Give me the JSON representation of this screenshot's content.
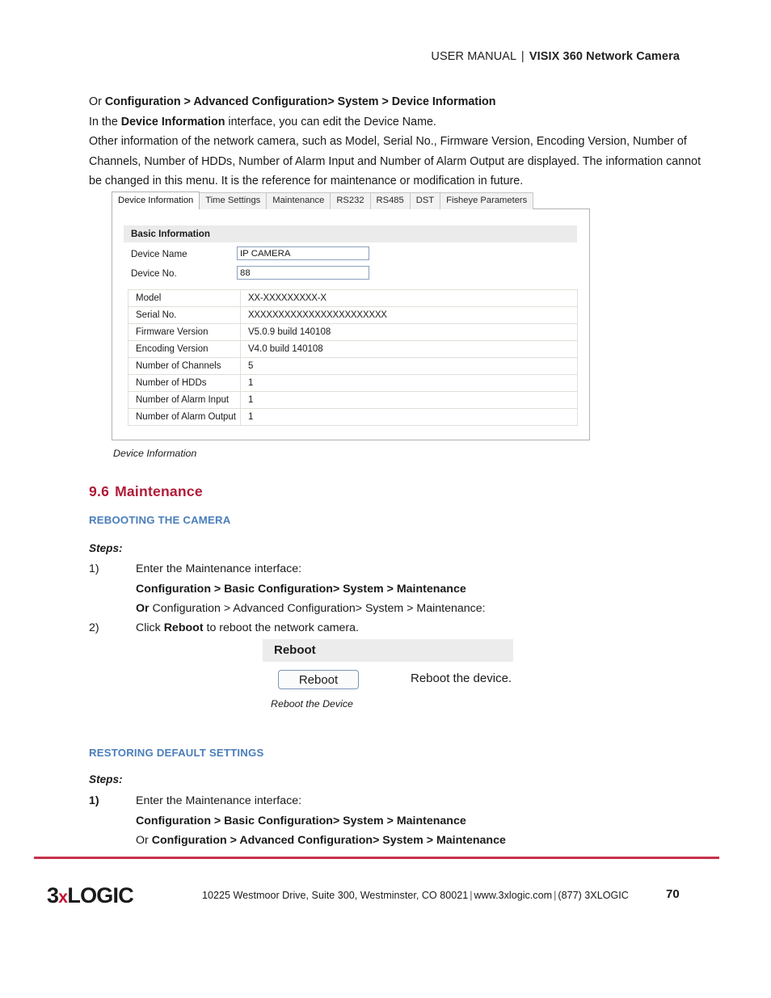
{
  "header": {
    "label": "USER MANUAL",
    "separator": "|",
    "title": "VISIX 360 Network Camera"
  },
  "intro": {
    "line1_prefix": "Or ",
    "line1_bold": "Configuration > Advanced Configuration> System > Device Information",
    "line2_prefix": "In the ",
    "line2_bold": "Device Information",
    "line2_suffix": " interface, you can edit the Device Name.",
    "line3": "Other information of the network camera, such as Model, Serial No., Firmware Version, Encoding Version, Number of Channels, Number of HDDs, Number of Alarm Input and Number of Alarm Output are displayed. The information cannot be changed in this menu. It is the reference for maintenance or modification in future."
  },
  "device_info_shot": {
    "tabs": [
      {
        "label": "Device Information",
        "active": true
      },
      {
        "label": "Time Settings",
        "active": false
      },
      {
        "label": "Maintenance",
        "active": false
      },
      {
        "label": "RS232",
        "active": false
      },
      {
        "label": "RS485",
        "active": false
      },
      {
        "label": "DST",
        "active": false
      },
      {
        "label": "Fisheye Parameters",
        "active": false
      }
    ],
    "panel_title": "Basic Information",
    "fields": [
      {
        "label": "Device Name",
        "value": "IP CAMERA"
      },
      {
        "label": "Device No.",
        "value": "88"
      }
    ],
    "table": [
      {
        "key": "Model",
        "value": "XX-XXXXXXXXX-X"
      },
      {
        "key": "Serial No.",
        "value": "XXXXXXXXXXXXXXXXXXXXXXX"
      },
      {
        "key": "Firmware Version",
        "value": "V5.0.9 build 140108"
      },
      {
        "key": "Encoding Version",
        "value": "V4.0 build 140108"
      },
      {
        "key": "Number of Channels",
        "value": "5"
      },
      {
        "key": "Number of HDDs",
        "value": "1"
      },
      {
        "key": "Number of Alarm Input",
        "value": "1"
      },
      {
        "key": "Number of Alarm Output",
        "value": "1"
      }
    ],
    "caption": "Device Information"
  },
  "section": {
    "number": "9.6",
    "title": "Maintenance",
    "accent_color": "#b01b38",
    "subheading_color": "#4a7ebb"
  },
  "reboot_section": {
    "heading": "REBOOTING THE CAMERA",
    "steps_label": "Steps:",
    "step1_num": "1)",
    "step1_text": "Enter the Maintenance interface:",
    "step1_path_bold": "Configuration > Basic Configuration> System > Maintenance",
    "step1_or_bold": "Or",
    "step1_or_rest": " Configuration > Advanced Configuration> System > Maintenance:",
    "step2_num": "2)",
    "step2_prefix": "Click ",
    "step2_bold": "Reboot",
    "step2_suffix": " to reboot the network camera.",
    "shot": {
      "panel_title": "Reboot",
      "button_label": "Reboot",
      "description": "Reboot the device.",
      "caption": "Reboot the Device"
    }
  },
  "restore_section": {
    "heading": "RESTORING DEFAULT SETTINGS",
    "steps_label": "Steps:",
    "step1_num": "1)",
    "step1_text": "Enter the Maintenance interface:",
    "step1_path_bold": "Configuration > Basic Configuration> System > Maintenance",
    "step1_or_prefix": "Or ",
    "step1_or_bold": "Configuration > Advanced Configuration> System > Maintenance"
  },
  "footer": {
    "logo_3": "3",
    "logo_x": "x",
    "logo_logic": "LOGIC",
    "address": "10225 Westmoor Drive, Suite 300, Westminster, CO 80021",
    "sep1": "|",
    "website": "www.3xlogic.com",
    "sep2": "|",
    "phone": "(877) 3XLOGIC",
    "page_number": "70",
    "rule_color": "#c8304b"
  }
}
